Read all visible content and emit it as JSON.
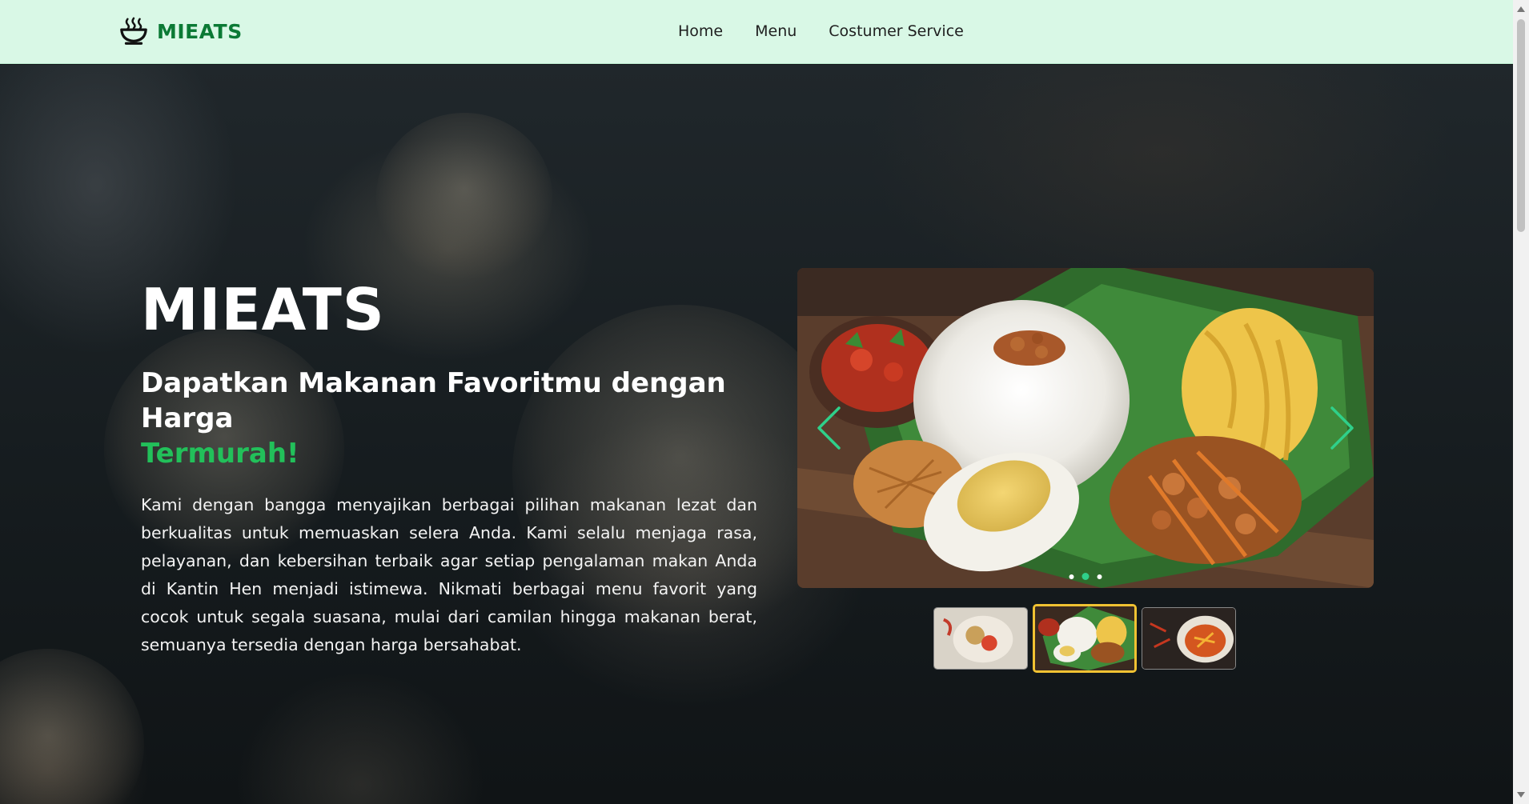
{
  "navbar": {
    "brand": "MIEATS",
    "brand_icon": "steaming-bowl-icon",
    "links": [
      "Home",
      "Menu",
      "Costumer Service"
    ]
  },
  "hero": {
    "title": "MIEATS",
    "subtitle": "Dapatkan Makanan Favoritmu dengan Harga",
    "subtitle_accent": "Termurah!",
    "description": "Kami dengan bangga menyajikan berbagai pilihan makanan lezat dan berkualitas untuk memuaskan selera Anda. Kami selalu menjaga rasa, pelayanan, dan kebersihan terbaik agar setiap pengalaman makan Anda di Kantin Hen menjadi istimewa. Nikmati berbagai menu favorit yang cocok untuk segala suasana, mulai dari camilan hingga makanan berat, semuanya tersedia dengan harga bersahabat."
  },
  "carousel": {
    "slide_count": 3,
    "active_index": 1,
    "prev_icon": "chevron-left-icon",
    "next_icon": "chevron-right-icon"
  },
  "colors": {
    "navbar_bg": "#d9f8e6",
    "brand": "#0b7a35",
    "accent": "#22c05a",
    "arrow": "#2fd08a",
    "active_thumb_border": "#f1c232"
  }
}
